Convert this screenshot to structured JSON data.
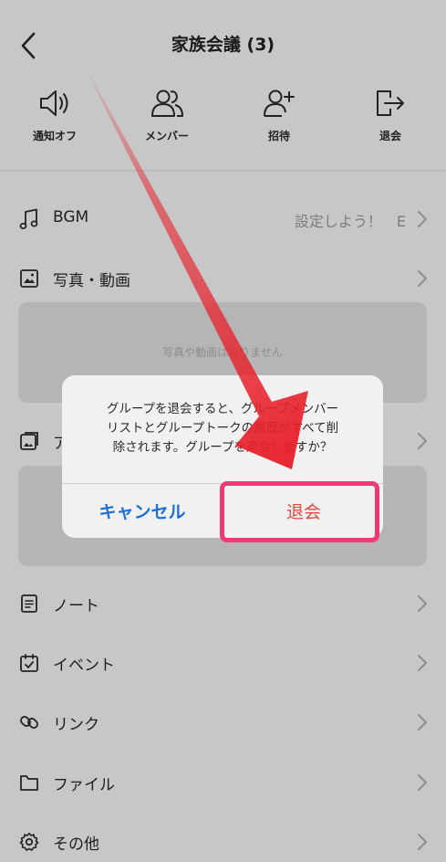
{
  "header": {
    "title": "家族会議 (3)"
  },
  "actions": [
    {
      "label": "通知オフ",
      "icon": "speaker-icon"
    },
    {
      "label": "メンバー",
      "icon": "members-icon"
    },
    {
      "label": "招待",
      "icon": "add-person-icon"
    },
    {
      "label": "退会",
      "icon": "exit-icon"
    }
  ],
  "menu": {
    "bgm": {
      "label": "BGM",
      "value": "設定しよう！",
      "value_extra": "E"
    },
    "photos": {
      "label": "写真・動画",
      "empty_text": "写真や動画はありません"
    },
    "album": {
      "label": "ア"
    },
    "note": {
      "label": "ノート"
    },
    "event": {
      "label": "イベント"
    },
    "link": {
      "label": "リンク"
    },
    "file": {
      "label": "ファイル"
    },
    "other": {
      "label": "その他"
    }
  },
  "dialog": {
    "message_line1": "グループを退会すると、グループメンバー",
    "message_line2": "リストとグループトークの履歴がすべて削",
    "message_line3": "除されます。グループを退会しますか？",
    "cancel_label": "キャンセル",
    "leave_label": "退会"
  },
  "colors": {
    "cancel": "#1e6fd0",
    "leave": "#e5483f",
    "highlight": "#ee3a74",
    "arrow": "#e8202a"
  }
}
